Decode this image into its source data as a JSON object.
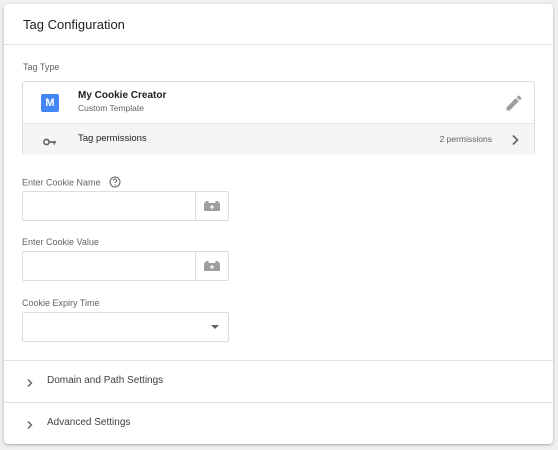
{
  "header": {
    "title": "Tag Configuration"
  },
  "tag_type": {
    "section_label": "Tag Type",
    "template": {
      "icon_letter": "M",
      "name": "My Cookie Creator",
      "subtitle": "Custom Template",
      "edit_icon": "pencil-icon"
    },
    "permissions": {
      "icon": "key-icon",
      "label": "Tag permissions",
      "count": "2 permissions",
      "chevron": "chevron-right-icon"
    }
  },
  "fields": {
    "cookie_name": {
      "label": "Enter Cookie Name",
      "value": "",
      "help_icon": "help-circle-icon",
      "variable_icon": "variable-brick-icon"
    },
    "cookie_value": {
      "label": "Enter Cookie Value",
      "value": "",
      "variable_icon": "variable-brick-icon"
    },
    "cookie_expiry": {
      "label": "Cookie Expiry Time",
      "selected": ""
    }
  },
  "sections": [
    {
      "label": "Domain and Path Settings",
      "expanded": false
    },
    {
      "label": "Advanced Settings",
      "expanded": false
    }
  ],
  "colors": {
    "accent": "#4285f4",
    "border": "#dadce0",
    "muted": "#5f6368"
  }
}
